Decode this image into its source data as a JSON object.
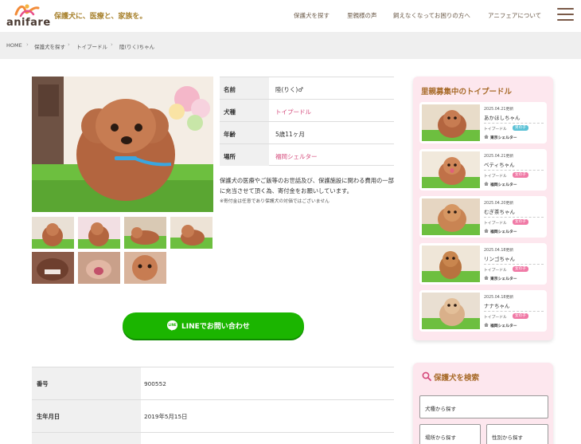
{
  "header": {
    "logo_text": "anifare",
    "tagline": "保護犬に、医療と、家族を。",
    "nav": [
      {
        "label": "保護犬を探す"
      },
      {
        "label": "里親様の声"
      },
      {
        "label": "飼えなくなってお困りの方へ"
      },
      {
        "label": "アニフェアについて"
      }
    ],
    "colors": {
      "accent_pink": "#d4487a",
      "brand_gold": "#a8822e"
    }
  },
  "breadcrumb": [
    "HOME",
    "保護犬を探す",
    "トイプードル",
    "陸(りく)ちゃん"
  ],
  "profile": {
    "rows": [
      {
        "key": "名前",
        "value": "陸(りく)♂"
      },
      {
        "key": "犬種",
        "value": "トイプードル"
      },
      {
        "key": "年齢",
        "value": "5歳11ヶ月"
      },
      {
        "key": "場所",
        "value": "福岡シェルター"
      }
    ],
    "description": "保護犬の医療やご飯等のお世話及び、保護施設に関わる費用の一部に充当させて頂く為、寄付金をお願いしています。",
    "note": "※寄付金は任意であり保護犬の対価ではございません"
  },
  "line_button": {
    "label": "LINEでお問い合わせ",
    "icon_text": "LINE",
    "color": "#1bb500"
  },
  "details": [
    {
      "key": "番号",
      "value": "900552"
    },
    {
      "key": "生年月日",
      "value": "2019年5月15日"
    }
  ],
  "sidebar": {
    "title": "里親募集中のトイプードル",
    "dogs": [
      {
        "date": "2025.04.21更新",
        "name": "あかほしちゃん",
        "breed": "トイプードル",
        "sex": "男の子",
        "shelter": "東京シェルター"
      },
      {
        "date": "2025.04.21更新",
        "name": "ベティちゃん",
        "breed": "トイプードル",
        "sex": "女の子",
        "shelter": "福岡シェルター"
      },
      {
        "date": "2025.04.20更新",
        "name": "むぎ茶ちゃん",
        "breed": "トイプードル",
        "sex": "女の子",
        "shelter": "福岡シェルター"
      },
      {
        "date": "2025.04.18更新",
        "name": "リンゴちゃん",
        "breed": "トイプードル",
        "sex": "女の子",
        "shelter": "東京シェルター"
      },
      {
        "date": "2025.04.18更新",
        "name": "ナナちゃん",
        "breed": "トイプードル",
        "sex": "女の子",
        "shelter": "福岡シェルター"
      }
    ]
  },
  "search": {
    "title": "保護犬を検索",
    "breed_select": "犬種から探す",
    "place_select": "場所から探す",
    "sex_select": "性別から探す"
  }
}
